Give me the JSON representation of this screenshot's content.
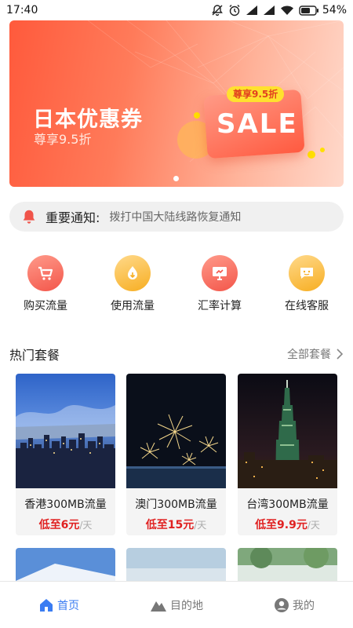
{
  "status_bar": {
    "time": "17:40",
    "battery": "54%"
  },
  "banner": {
    "title": "日本优惠券",
    "subtitle": "尊享9.5折",
    "tag": "尊享9.5折",
    "sale": "SALE"
  },
  "notice": {
    "title": "重要通知:",
    "text": "拨打中国大陆线路恢复通知"
  },
  "features": [
    {
      "label": "购买流量",
      "icon": "shopping-cart-icon"
    },
    {
      "label": "使用流量",
      "icon": "drop-icon"
    },
    {
      "label": "汇率计算",
      "icon": "monitor-icon"
    },
    {
      "label": "在线客服",
      "icon": "chat-icon"
    }
  ],
  "section": {
    "title": "热门套餐",
    "more": "全部套餐"
  },
  "packages": [
    {
      "name": "香港300MB流量",
      "price": "低至6元",
      "unit": "/天"
    },
    {
      "name": "澳门300MB流量",
      "price": "低至15元",
      "unit": "/天"
    },
    {
      "name": "台湾300MB流量",
      "price": "低至9.9元",
      "unit": "/天"
    }
  ],
  "nav": {
    "home": "首页",
    "destination": "目的地",
    "mine": "我的"
  },
  "colors": {
    "accent": "#3a7cf2",
    "price": "#e02121",
    "banner_start": "#ff5a3c"
  }
}
